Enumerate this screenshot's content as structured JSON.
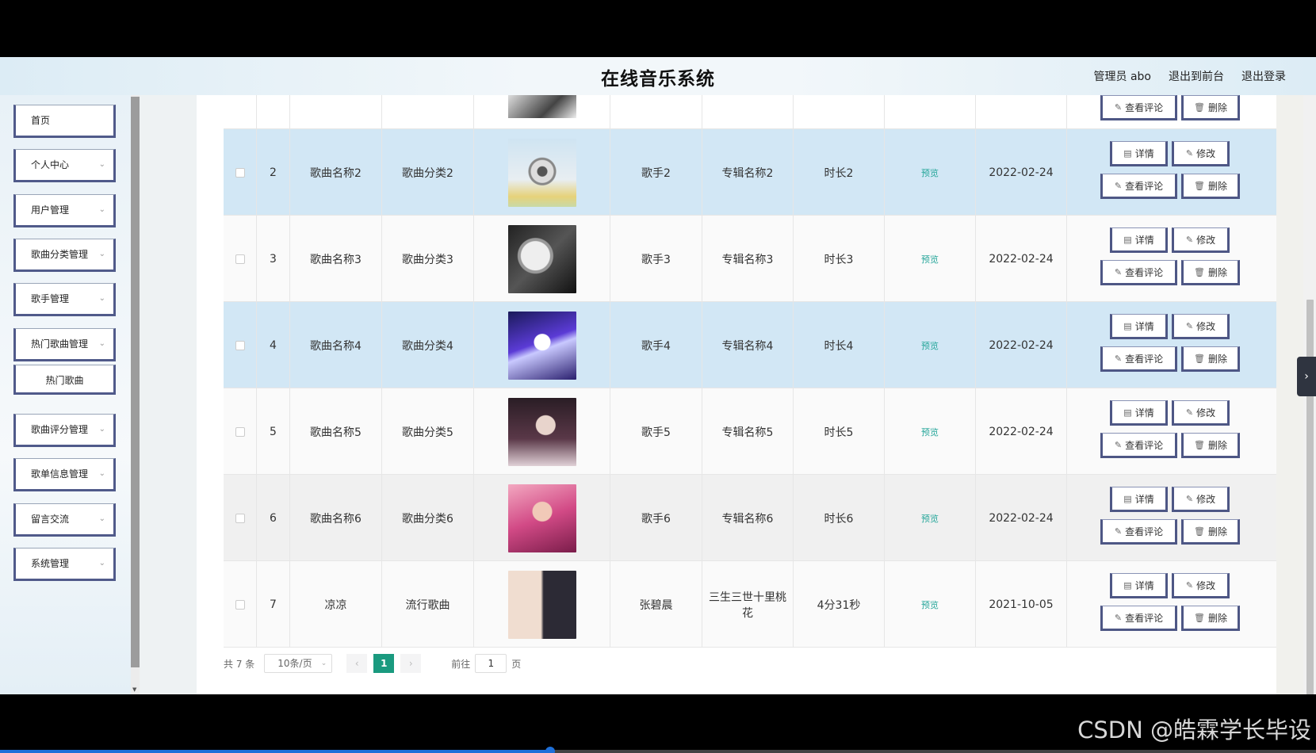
{
  "header": {
    "title": "在线音乐系统",
    "links": [
      "管理员 abo",
      "退出到前台",
      "退出登录"
    ]
  },
  "sidebar": {
    "items": [
      {
        "label": "首页",
        "expandable": false
      },
      {
        "label": "个人中心",
        "expandable": true
      },
      {
        "label": "用户管理",
        "expandable": true
      },
      {
        "label": "歌曲分类管理",
        "expandable": true
      },
      {
        "label": "歌手管理",
        "expandable": true
      },
      {
        "label": "热门歌曲管理",
        "expandable": true
      },
      {
        "label": "热门歌曲",
        "expandable": false,
        "sub": true
      },
      {
        "label": "歌曲评分管理",
        "expandable": true
      },
      {
        "label": "歌单信息管理",
        "expandable": true
      },
      {
        "label": "留言交流",
        "expandable": true
      },
      {
        "label": "系统管理",
        "expandable": true
      }
    ]
  },
  "table": {
    "rows": [
      {
        "index": "2",
        "name": "歌曲名称2",
        "category": "歌曲分类2",
        "singer": "歌手2",
        "album": "专辑名称2",
        "duration": "时长2",
        "preview": "预览",
        "date": "2022-02-24",
        "style": "hl",
        "img": "img-vinyl"
      },
      {
        "index": "3",
        "name": "歌曲名称3",
        "category": "歌曲分类3",
        "singer": "歌手3",
        "album": "专辑名称3",
        "duration": "时长3",
        "preview": "预览",
        "date": "2022-02-24",
        "style": "white",
        "img": "img-mono"
      },
      {
        "index": "4",
        "name": "歌曲名称4",
        "category": "歌曲分类4",
        "singer": "歌手4",
        "album": "专辑名称4",
        "duration": "时长4",
        "preview": "预览",
        "date": "2022-02-24",
        "style": "hl",
        "img": "img-purple"
      },
      {
        "index": "5",
        "name": "歌曲名称5",
        "category": "歌曲分类5",
        "singer": "歌手5",
        "album": "专辑名称5",
        "duration": "时长5",
        "preview": "预览",
        "date": "2022-02-24",
        "style": "white",
        "img": "img-dark"
      },
      {
        "index": "6",
        "name": "歌曲名称6",
        "category": "歌曲分类6",
        "singer": "歌手6",
        "album": "专辑名称6",
        "duration": "时长6",
        "preview": "预览",
        "date": "2022-02-24",
        "style": "grey",
        "img": "img-pink"
      },
      {
        "index": "7",
        "name": "凉凉",
        "category": "流行歌曲",
        "singer": "张碧晨",
        "album": "三生三世十里桃花",
        "duration": "4分31秒",
        "preview": "预览",
        "date": "2021-10-05",
        "style": "white",
        "img": "img-couple"
      }
    ],
    "actions": {
      "detail": "详情",
      "edit": "修改",
      "comments": "查看评论",
      "delete": "删除"
    }
  },
  "pager": {
    "total": "共 7 条",
    "page_size": "10条/页",
    "current": "1",
    "goto_label": "前往",
    "goto_value": "1",
    "page_unit": "页"
  },
  "watermark": "CSDN @皓霖学长毕设",
  "colors": {
    "accent": "#1a9a7f",
    "highlight_row": "#d2e7f5",
    "preview_text": "#26a69a"
  }
}
